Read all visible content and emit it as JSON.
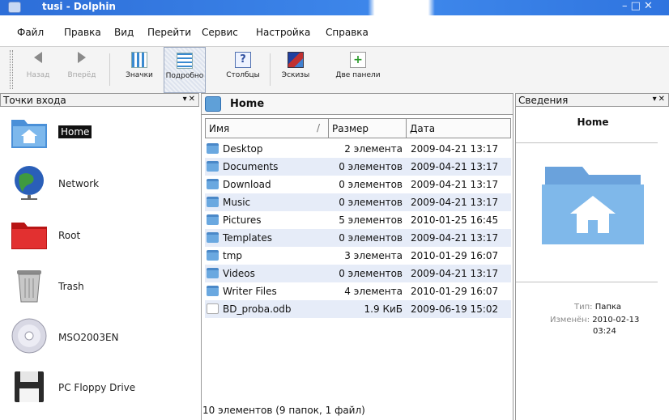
{
  "window": {
    "title": "tusi - Dolphin",
    "controls": "– □ ✕"
  },
  "menu": [
    "Файл",
    "Правка",
    "Вид",
    "Перейти",
    "Сервис",
    "Настройка",
    "Справка"
  ],
  "toolbar": {
    "back": "Назад",
    "forward": "Вперёд",
    "icons": "Значки",
    "details": "Подробно",
    "columns": "Столбцы",
    "previews": "Эскизы",
    "split": "Две панели"
  },
  "places": {
    "title": "Точки входа",
    "items": [
      "Home",
      "Network",
      "Root",
      "Trash",
      "MSO2003EN",
      "PC Floppy Drive"
    ]
  },
  "location": {
    "title": "Home"
  },
  "columns": {
    "name": "Имя",
    "size": "Размер",
    "date": "Дата"
  },
  "files": [
    {
      "name": "Desktop",
      "size": "2 элемента",
      "date": "2009-04-21 13:17"
    },
    {
      "name": "Documents",
      "size": "0 элементов",
      "date": "2009-04-21 13:17"
    },
    {
      "name": "Download",
      "size": "0 элементов",
      "date": "2009-04-21 13:17"
    },
    {
      "name": "Music",
      "size": "0 элементов",
      "date": "2009-04-21 13:17"
    },
    {
      "name": "Pictures",
      "size": "5 элементов",
      "date": "2010-01-25 16:45"
    },
    {
      "name": "Templates",
      "size": "0 элементов",
      "date": "2009-04-21 13:17"
    },
    {
      "name": "tmp",
      "size": "3 элемента",
      "date": "2010-01-29 16:07"
    },
    {
      "name": "Videos",
      "size": "0 элементов",
      "date": "2009-04-21 13:17"
    },
    {
      "name": "Writer Files",
      "size": "4 элемента",
      "date": "2010-01-29 16:07"
    },
    {
      "name": "BD_proba.odb",
      "size": "1.9 КиБ",
      "date": "2009-06-19 15:02"
    }
  ],
  "status": "10 элементов (9 папок, 1 файл)",
  "info": {
    "panel_title": "Сведения",
    "title": "Home",
    "type_label": "Тип:",
    "type_value": "Папка",
    "modified_label": "Изменён:",
    "modified_value": "2010-02-13",
    "modified_time": "03:24"
  }
}
